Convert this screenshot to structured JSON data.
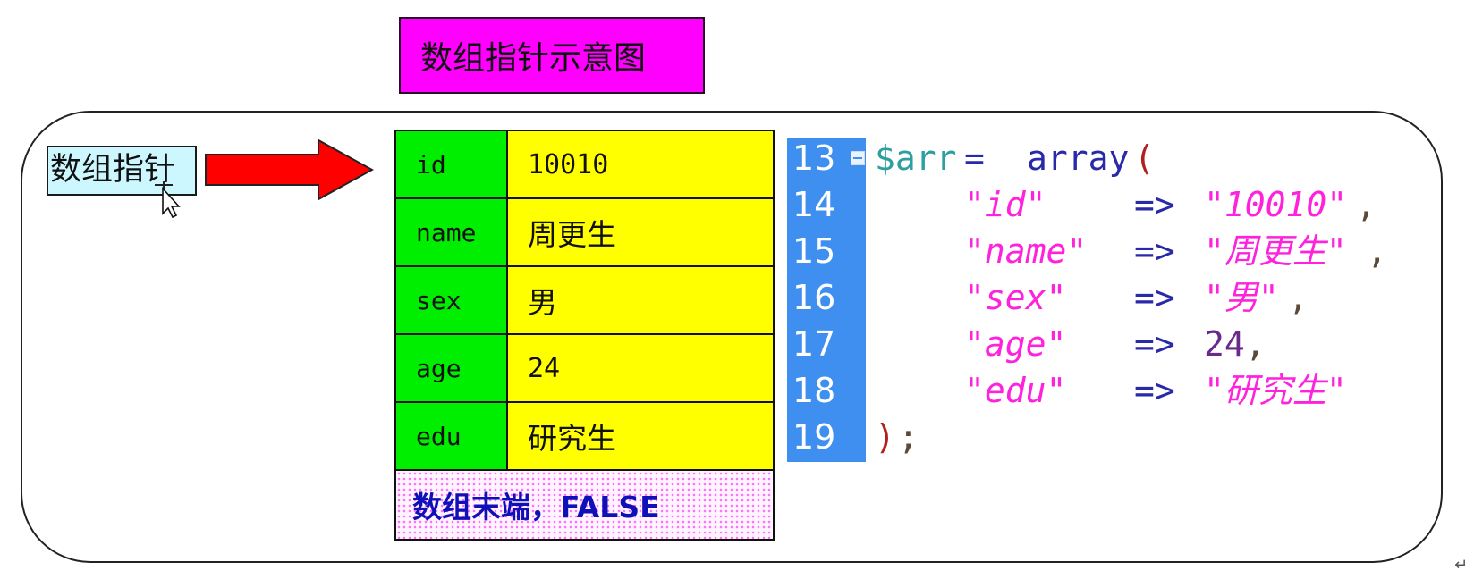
{
  "title": "数组指针示意图",
  "pointer_label": "数组指针",
  "table": {
    "rows": [
      {
        "key": "id",
        "value": "10010"
      },
      {
        "key": "name",
        "value": "周更生"
      },
      {
        "key": "sex",
        "value": "男"
      },
      {
        "key": "age",
        "value": "24"
      },
      {
        "key": "edu",
        "value": "研究生"
      }
    ],
    "end_label": "数组末端，FALSE"
  },
  "code": {
    "line_numbers": [
      "13",
      "14",
      "15",
      "16",
      "17",
      "18",
      "19"
    ],
    "var": "$arr",
    "assign": "=",
    "func": "array",
    "open": "(",
    "close": ")",
    "semicolon": ";",
    "arrow": "=>",
    "entries": [
      {
        "key": "\"id\"",
        "value": "\"10010\"",
        "comma": ","
      },
      {
        "key": "\"name\"",
        "value": "\"周更生\"",
        "comma": ","
      },
      {
        "key": "\"sex\"",
        "value": "\"男\"",
        "comma": ","
      },
      {
        "key": "\"age\"",
        "value": "24",
        "comma": ","
      },
      {
        "key": "\"edu\"",
        "value": "\"研究生\"",
        "comma": ""
      }
    ]
  },
  "colors": {
    "title_bg": "#ff00ff",
    "label_bg": "#ccf7ff",
    "key_bg": "#00ee00",
    "value_bg": "#ffff00",
    "arrow": "#ff0000",
    "gutter": "#3e8ff0",
    "string": "#ff22dd"
  }
}
